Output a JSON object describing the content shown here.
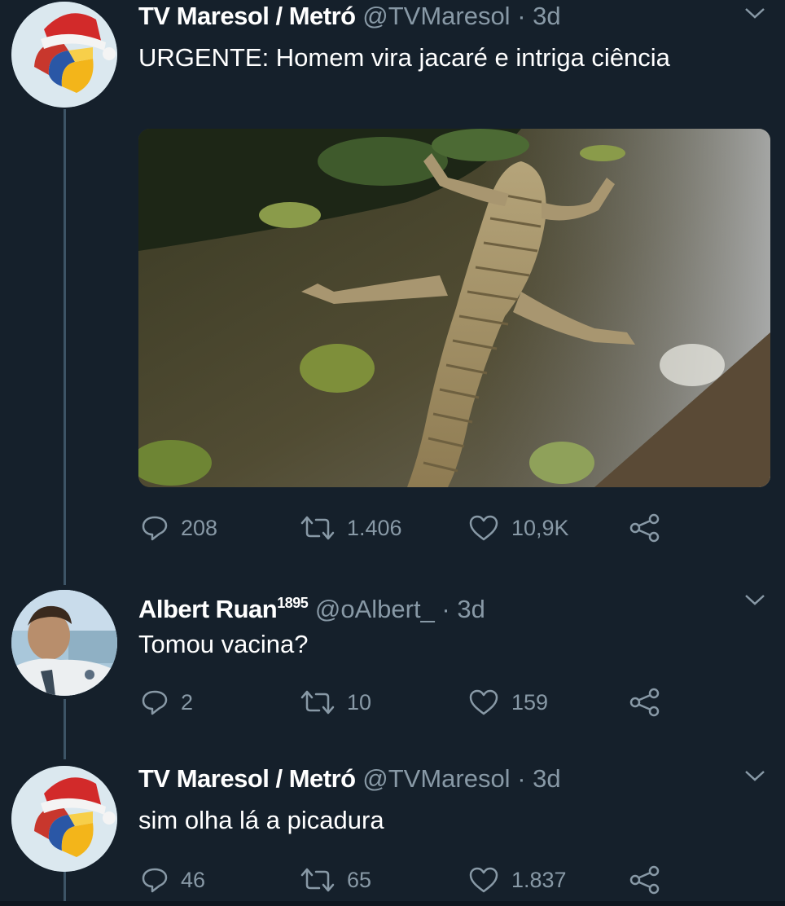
{
  "colors": {
    "background": "#15202b",
    "text_primary": "#ffffff",
    "text_secondary": "#8899a6",
    "thread_line": "#3d5466"
  },
  "tweets": [
    {
      "name": "TV Maresol / Metró",
      "name_suffix": "",
      "handle": "@TVMaresol",
      "dot": "·",
      "time": "3d",
      "text": "URGENTE: Homem vira jacaré e intriga ciência",
      "media_description_icon": "alligator-photo",
      "replies": "208",
      "retweets": "1.406",
      "likes": "10,9K"
    },
    {
      "name": "Albert Ruan",
      "name_suffix": "1895",
      "handle": "@oAlbert_",
      "dot": "·",
      "time": "3d",
      "text": "Tomou vacina?",
      "replies": "2",
      "retweets": "10",
      "likes": "159"
    },
    {
      "name": "TV Maresol / Metró",
      "name_suffix": "",
      "handle": "@TVMaresol",
      "dot": "·",
      "time": "3d",
      "text": "sim olha lá a picadura",
      "replies": "46",
      "retweets": "65",
      "likes": "1.837"
    }
  ],
  "icons": {
    "reply": "reply-icon",
    "retweet": "retweet-icon",
    "like": "heart-icon",
    "share": "share-icon",
    "menu": "chevron-down-icon"
  }
}
